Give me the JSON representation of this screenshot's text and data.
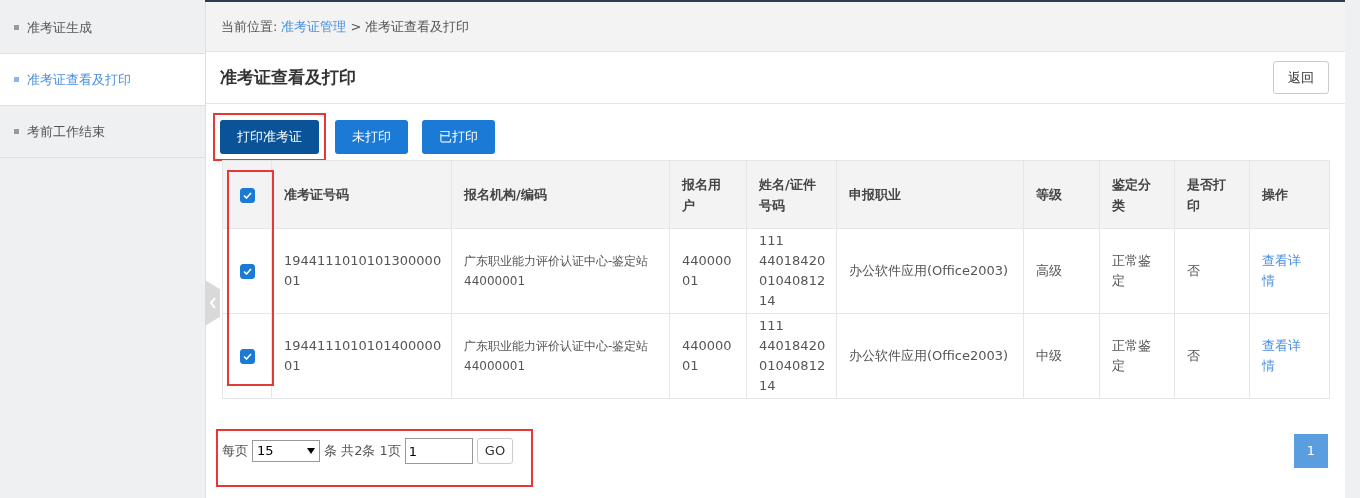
{
  "sidebar": {
    "items": [
      {
        "label": "准考证生成",
        "selected": false
      },
      {
        "label": "准考证查看及打印",
        "selected": true
      },
      {
        "label": "考前工作结束",
        "selected": false
      }
    ]
  },
  "breadcrumb": {
    "prefix": "当前位置:",
    "link": "准考证管理",
    "separator": ">",
    "current": "准考证查看及打印"
  },
  "page_title": "准考证查看及打印",
  "back_button": "返回",
  "toolbar": [
    {
      "label": "打印准考证",
      "selected": true,
      "highlighted": true
    },
    {
      "label": "未打印",
      "selected": false,
      "highlighted": false
    },
    {
      "label": "已打印",
      "selected": false,
      "highlighted": false
    }
  ],
  "table": {
    "select_all_checked": true,
    "columns": [
      "准考证号码",
      "报名机构/编码",
      "报名用户",
      "姓名/证件号码",
      "申报职业",
      "等级",
      "鉴定分类",
      "是否打印",
      "操作"
    ],
    "rows": [
      {
        "checked": true,
        "ticket_no": "1944111010101300000 01",
        "org": "广东职业能力评价认证中心-鉴定站",
        "org_code": "44000001",
        "user": "440000 01",
        "id_lines": [
          "111",
          "44018420",
          "01040812",
          "14"
        ],
        "occupation": "办公软件应用(Office2003)",
        "level_name": "高级",
        "category": "正常鉴定",
        "printed": "否",
        "action": "查看详情"
      },
      {
        "checked": true,
        "ticket_no": "1944111010101400000 01",
        "org": "广东职业能力评价认证中心-鉴定站",
        "org_code": "44000001",
        "user": "440000 01",
        "id_lines": [
          "111",
          "44018420",
          "01040812",
          "14"
        ],
        "occupation": "办公软件应用(Office2003)",
        "level_name": "中级",
        "category": "正常鉴定",
        "printed": "否",
        "action": "查看详情"
      }
    ]
  },
  "pagination": {
    "per_page_label": "每页",
    "per_page": "15",
    "summary": "条 共2条 1页",
    "page_input": "1",
    "go": "GO",
    "pages": [
      {
        "label": "1",
        "selected": true
      }
    ]
  }
}
